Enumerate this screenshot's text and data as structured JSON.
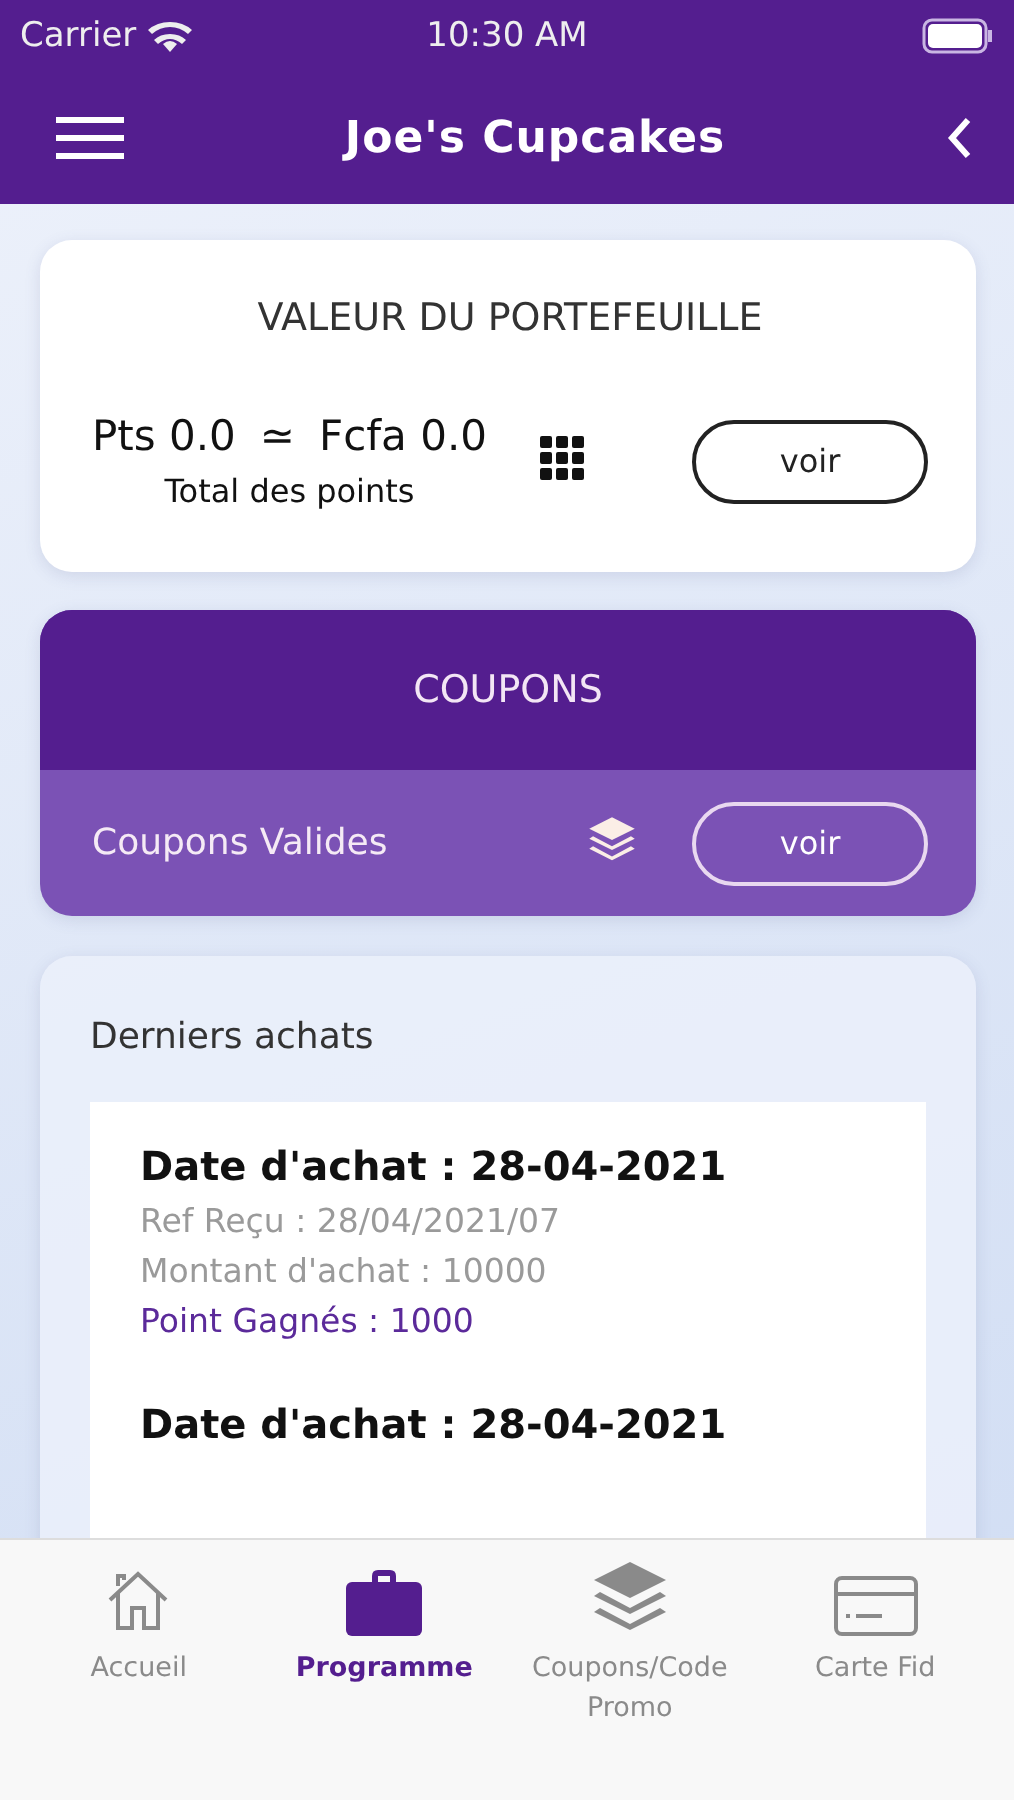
{
  "status_bar": {
    "carrier": "Carrier",
    "time": "10:30 AM"
  },
  "nav_bar": {
    "title": "Joe's Cupcakes"
  },
  "wallet": {
    "title": "VALEUR DU PORTEFEUILLE",
    "points": "Pts 0.0",
    "approx": "≃",
    "amount": "Fcfa 0.0",
    "caption": "Total des points",
    "button": "voir"
  },
  "coupons": {
    "title": "COUPONS",
    "label": "Coupons Valides",
    "button": "voir"
  },
  "purchases": {
    "title": "Derniers achats",
    "items": [
      {
        "date": "Date d'achat : 28-04-2021",
        "ref": "Ref Reçu : 28/04/2021/07",
        "amount": "Montant d'achat : 10000",
        "points": "Point Gagnés : 1000"
      },
      {
        "date": "Date d'achat : 28-04-2021"
      }
    ]
  },
  "tabs": [
    {
      "label": "Accueil",
      "kind": "home",
      "selected": false
    },
    {
      "label": "Programme",
      "kind": "briefcase",
      "selected": true
    },
    {
      "label": "Coupons/Code Promo",
      "kind": "layers",
      "selected": false
    },
    {
      "label": "Carte Fid",
      "kind": "card",
      "selected": false
    }
  ]
}
